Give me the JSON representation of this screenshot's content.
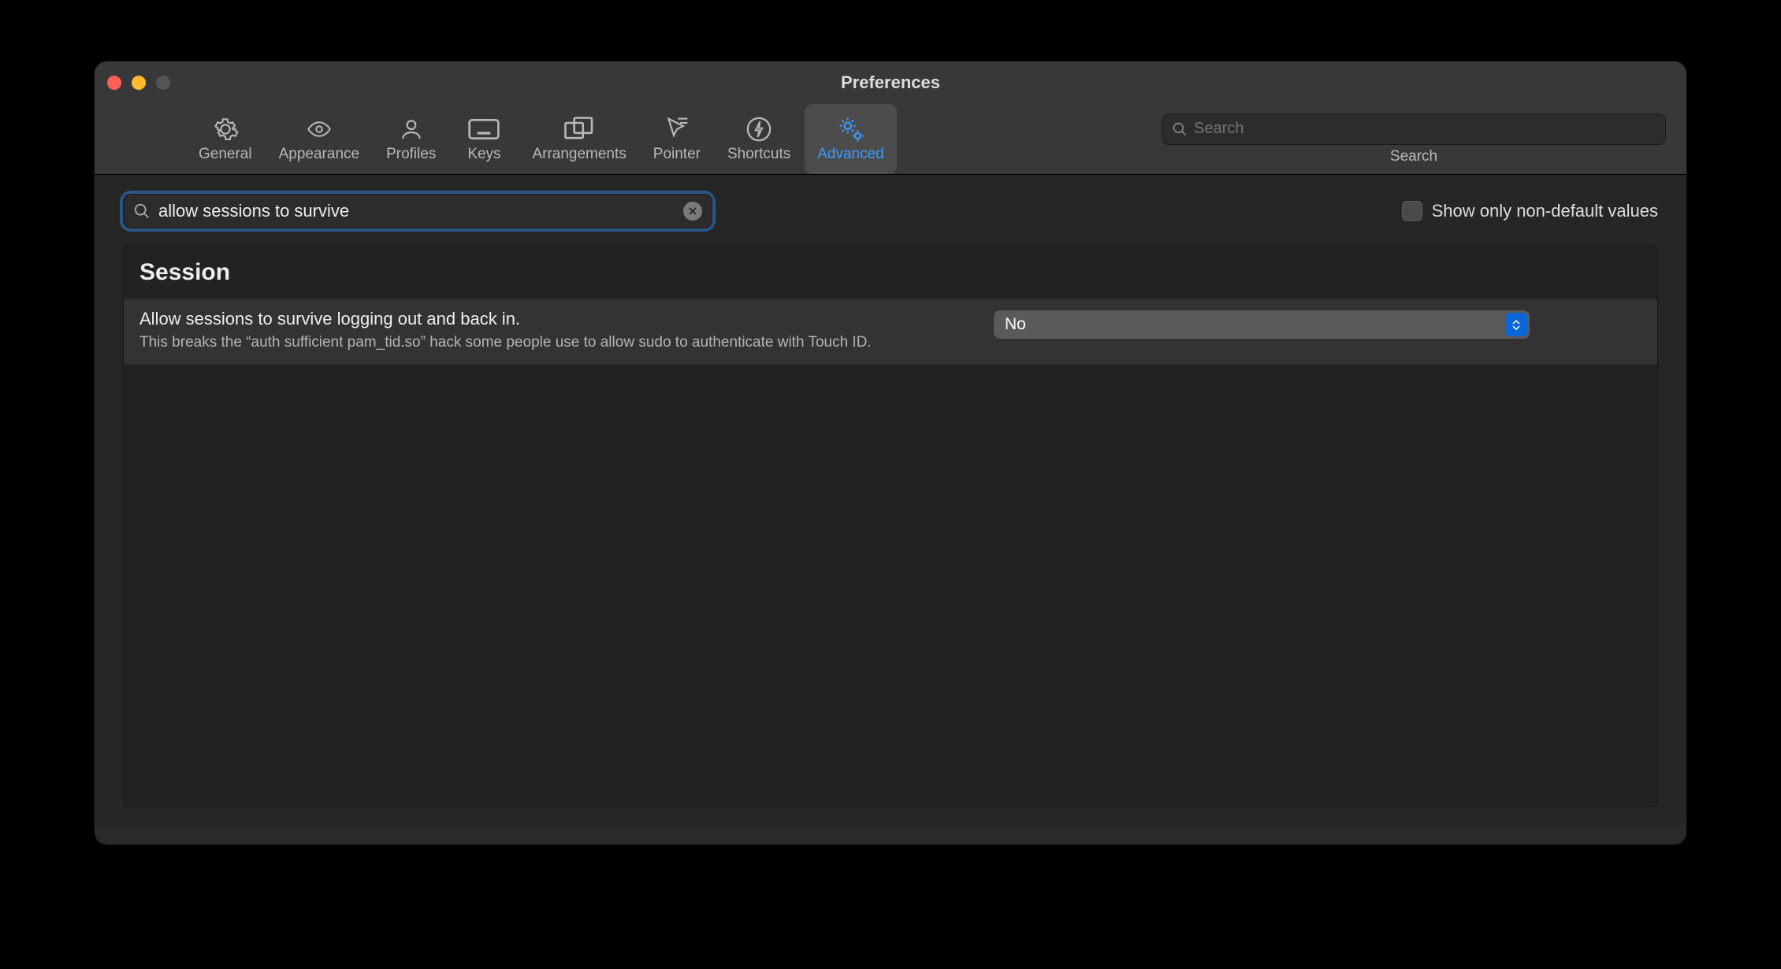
{
  "window": {
    "title": "Preferences"
  },
  "toolbar": {
    "tabs": [
      {
        "id": "general",
        "label": "General"
      },
      {
        "id": "appearance",
        "label": "Appearance"
      },
      {
        "id": "profiles",
        "label": "Profiles"
      },
      {
        "id": "keys",
        "label": "Keys"
      },
      {
        "id": "arrangements",
        "label": "Arrangements"
      },
      {
        "id": "pointer",
        "label": "Pointer"
      },
      {
        "id": "shortcuts",
        "label": "Shortcuts"
      },
      {
        "id": "advanced",
        "label": "Advanced",
        "active": true
      }
    ],
    "search": {
      "placeholder": "Search",
      "label": "Search"
    }
  },
  "filter": {
    "value": "allow sessions to survive",
    "show_non_default_label": "Show only non-default values"
  },
  "settings": {
    "section": "Session",
    "items": [
      {
        "title": "Allow sessions to survive logging out and back in.",
        "description": "This breaks the “auth sufficient pam_tid.so” hack some people use to allow sudo to authenticate with Touch ID.",
        "value": "No"
      }
    ]
  }
}
